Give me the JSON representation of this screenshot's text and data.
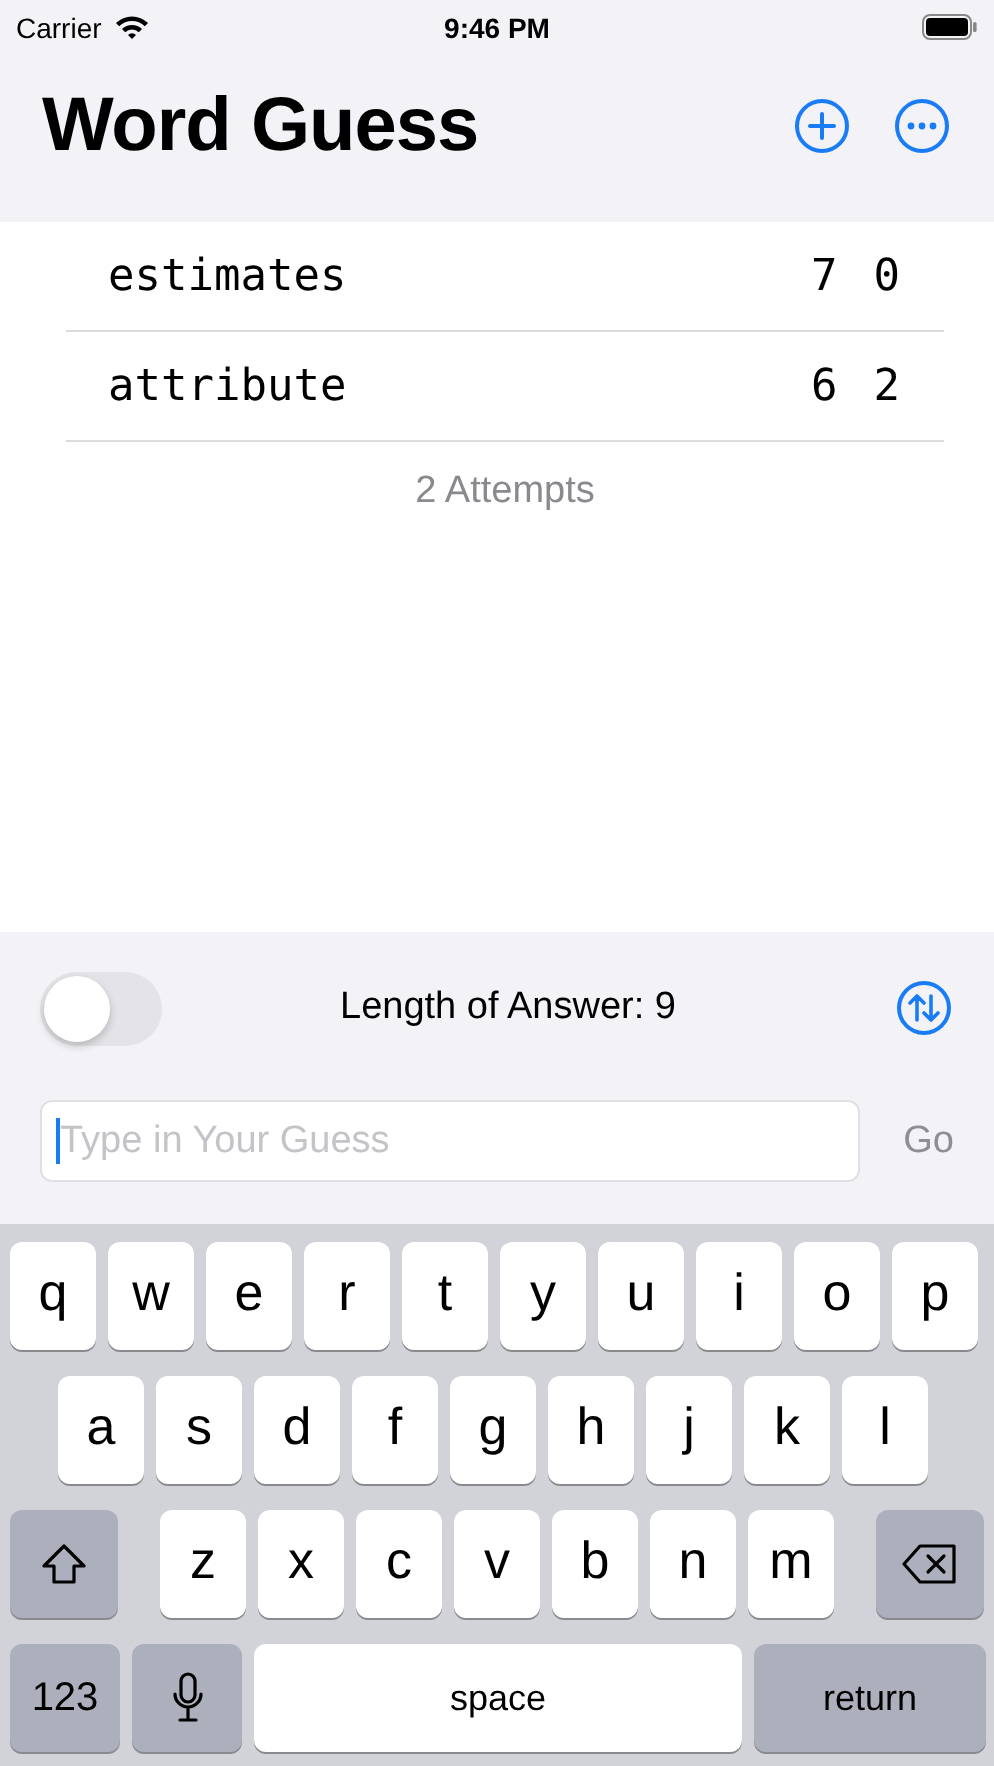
{
  "status_bar": {
    "carrier": "Carrier",
    "time": "9:46 PM"
  },
  "nav": {
    "title": "Word Guess",
    "actions": [
      {
        "kind": "add"
      },
      {
        "kind": "more"
      }
    ]
  },
  "attempts": [
    {
      "word": "estimates",
      "score_1": "7",
      "score_2": "0"
    },
    {
      "word": "attribute",
      "score_1": "6",
      "score_2": "2"
    }
  ],
  "attempts_count": "2 Attempts",
  "controls": {
    "toggle": {
      "on": false
    },
    "answer_length": "Length of Answer: 9",
    "sort_button": {
      "kind": "sort"
    }
  },
  "guess": {
    "placeholder": "Type in Your Guess",
    "focused": true,
    "go": {
      "label": "Go",
      "disabled": true
    }
  },
  "keyboard": {
    "top_row": [
      {
        "kind": "letter",
        "label": "q"
      },
      {
        "kind": "letter",
        "label": "w"
      },
      {
        "kind": "letter",
        "label": "e"
      },
      {
        "kind": "letter",
        "label": "r"
      },
      {
        "kind": "letter",
        "label": "t"
      },
      {
        "kind": "letter",
        "label": "y"
      },
      {
        "kind": "letter",
        "label": "u"
      },
      {
        "kind": "letter",
        "label": "i"
      },
      {
        "kind": "letter",
        "label": "o"
      },
      {
        "kind": "letter",
        "label": "p"
      }
    ],
    "middle_row": [
      {
        "kind": "letter",
        "label": "a"
      },
      {
        "kind": "letter",
        "label": "s"
      },
      {
        "kind": "letter",
        "label": "d"
      },
      {
        "kind": "letter",
        "label": "f"
      },
      {
        "kind": "letter",
        "label": "g"
      },
      {
        "kind": "letter",
        "label": "h"
      },
      {
        "kind": "letter",
        "label": "j"
      },
      {
        "kind": "letter",
        "label": "k"
      },
      {
        "kind": "letter",
        "label": "l"
      }
    ],
    "lower_row": [
      {
        "kind": "shift"
      },
      {
        "kind": "letter",
        "label": "z"
      },
      {
        "kind": "letter",
        "label": "x"
      },
      {
        "kind": "letter",
        "label": "c"
      },
      {
        "kind": "letter",
        "label": "v"
      },
      {
        "kind": "letter",
        "label": "b"
      },
      {
        "kind": "letter",
        "label": "n"
      },
      {
        "kind": "letter",
        "label": "m"
      },
      {
        "kind": "delete"
      }
    ],
    "bottom_row": [
      {
        "kind": "numbers",
        "label": "123"
      },
      {
        "kind": "mic"
      },
      {
        "kind": "space",
        "label": "space"
      },
      {
        "kind": "return",
        "label": "return"
      }
    ]
  }
}
